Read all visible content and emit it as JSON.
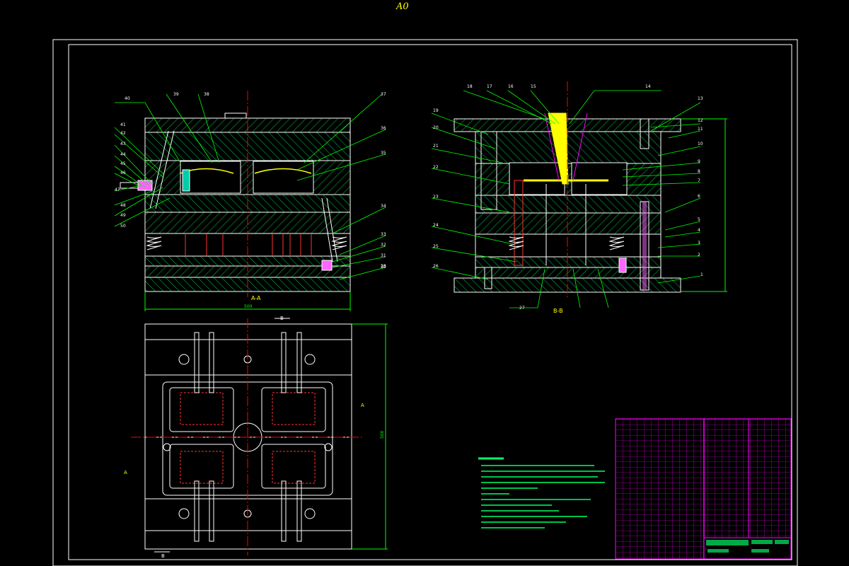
{
  "sheet": {
    "size_label": "A0"
  },
  "views": {
    "section_a": {
      "label": "A-A",
      "width_dim": "500"
    },
    "section_b": {
      "label": "B-B"
    },
    "plan": {
      "cut_a": "A",
      "cut_b": "B",
      "height_dim": "500"
    }
  },
  "balloons_left": [
    "40",
    "41",
    "42",
    "43",
    "44",
    "45",
    "46",
    "47",
    "48",
    "49",
    "50",
    "39",
    "38",
    "37",
    "36",
    "35",
    "34",
    "33",
    "32",
    "31",
    "30",
    "28"
  ],
  "balloons_right": [
    "18",
    "17",
    "16",
    "15",
    "14",
    "13",
    "12",
    "11",
    "10",
    "9",
    "8",
    "7",
    "6",
    "5",
    "4",
    "3",
    "2",
    "1",
    "19",
    "20",
    "21",
    "22",
    "23",
    "24",
    "25",
    "26",
    "27"
  ],
  "colors": {
    "background": "#000000",
    "frame": "#ffffff",
    "hatch": "#00ff66",
    "centerline": "#ff0000",
    "leader": "#00ff00",
    "highlight": "#ffff00",
    "cavity": "#ff00ff",
    "title_block": "#ff00ff"
  }
}
